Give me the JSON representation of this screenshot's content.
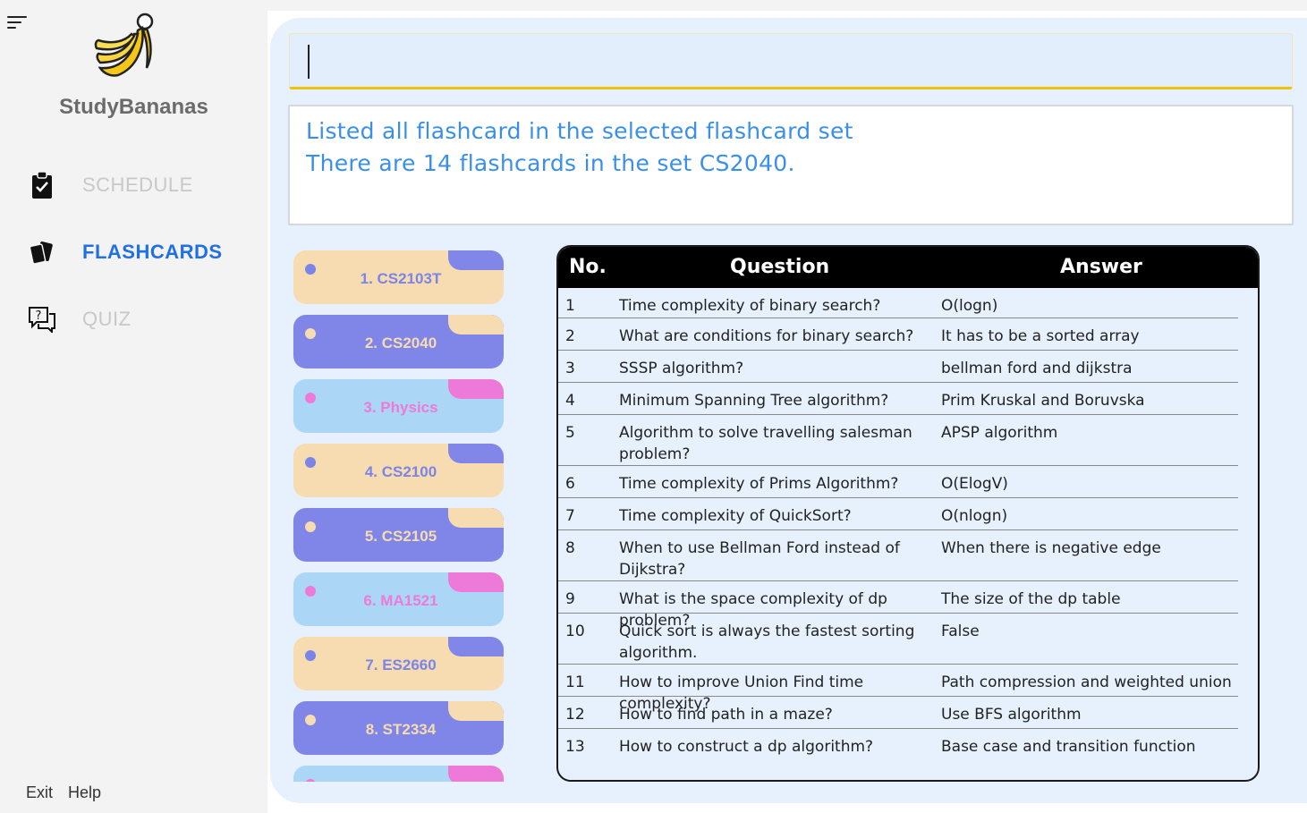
{
  "sidebar": {
    "brand": "StudyBananas",
    "nav": [
      {
        "label": "SCHEDULE",
        "icon": "clipboard-check-icon",
        "active": false
      },
      {
        "label": "FLASHCARDS",
        "icon": "cards-icon",
        "active": true
      },
      {
        "label": "QUIZ",
        "icon": "question-chat-icon",
        "active": false
      }
    ],
    "footer": {
      "exit": "Exit",
      "help": "Help"
    }
  },
  "command": {
    "value": "",
    "placeholder": ""
  },
  "result": {
    "line1": "Listed all flashcard in the selected flashcard set",
    "line2": "There are 14 flashcards in the set CS2040."
  },
  "sets": [
    {
      "label": "1. CS2103T",
      "theme": "cream"
    },
    {
      "label": "2. CS2040",
      "theme": "purple"
    },
    {
      "label": "3. Physics",
      "theme": "blue"
    },
    {
      "label": "4. CS2100",
      "theme": "cream"
    },
    {
      "label": "5. CS2105",
      "theme": "purple"
    },
    {
      "label": "6. MA1521",
      "theme": "blue"
    },
    {
      "label": "7. ES2660",
      "theme": "cream"
    },
    {
      "label": "8. ST2334",
      "theme": "purple"
    },
    {
      "label": "",
      "theme": "blue"
    }
  ],
  "colors": {
    "cream": {
      "bg": "#f6dcb0",
      "tab": "#8087e8",
      "dot": "#7b84e8",
      "text": "#7b84e8"
    },
    "purple": {
      "bg": "#7f86e8",
      "tab": "#f6dcb0",
      "dot": "#f6dcb0",
      "text": "#f6dcb0"
    },
    "blue": {
      "bg": "#acd6f5",
      "tab": "#ed7ad8",
      "dot": "#ed7ad8",
      "text": "#ed7ad8"
    }
  },
  "table": {
    "headers": {
      "no": "No.",
      "question": "Question",
      "answer": "Answer"
    },
    "rows": [
      {
        "no": "1",
        "question": "Time complexity of binary search?",
        "answer": "O(logn)"
      },
      {
        "no": "2",
        "question": "What are conditions for binary search?",
        "answer": "It has to be a sorted array"
      },
      {
        "no": "3",
        "question": "SSSP algorithm?",
        "answer": "bellman ford and dijkstra"
      },
      {
        "no": "4",
        "question": "Minimum Spanning Tree algorithm?",
        "answer": "Prim Kruskal and Boruvska"
      },
      {
        "no": "5",
        "question": "Algorithm to solve travelling salesman problem?",
        "answer": "APSP algorithm"
      },
      {
        "no": "6",
        "question": "Time complexity of Prims Algorithm?",
        "answer": "O(ElogV)"
      },
      {
        "no": "7",
        "question": "Time complexity of QuickSort?",
        "answer": "O(nlogn)"
      },
      {
        "no": "8",
        "question": "When to use Bellman Ford instead of Dijkstra?",
        "answer": "When there is negative edge"
      },
      {
        "no": "9",
        "question": "What is the space complexity of dp problem?",
        "answer": "The size of the dp table"
      },
      {
        "no": "10",
        "question": "Quick sort is always the fastest sorting algorithm.",
        "answer": "False"
      },
      {
        "no": "11",
        "question": "How to improve Union Find time complexity?",
        "answer": "Path compression and weighted union"
      },
      {
        "no": "12",
        "question": "How to find path in a maze?",
        "answer": "Use BFS algorithm"
      },
      {
        "no": "13",
        "question": "How to construct a dp algorithm?",
        "answer": "Base case and transition function"
      }
    ]
  }
}
